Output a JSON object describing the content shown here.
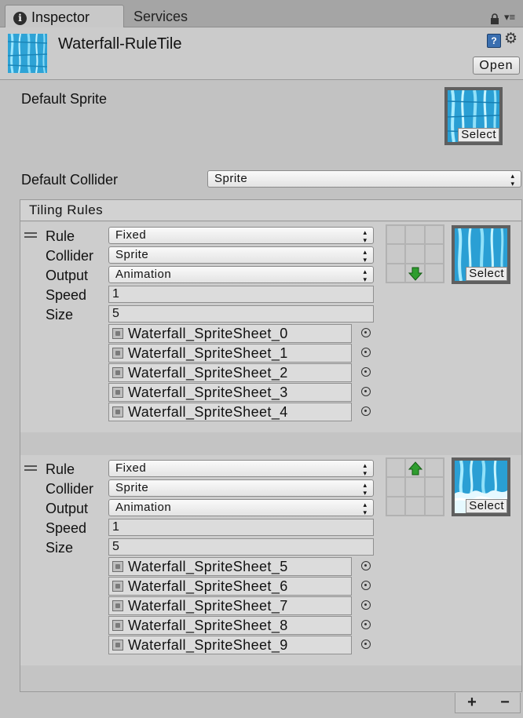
{
  "tabs": {
    "inspector": "Inspector",
    "services": "Services"
  },
  "asset": {
    "title": "Waterfall-RuleTile",
    "open_label": "Open"
  },
  "default_sprite": {
    "label": "Default Sprite",
    "select_label": "Select"
  },
  "default_collider": {
    "label": "Default Collider",
    "value": "Sprite"
  },
  "tiling_rules": {
    "title": "Tiling Rules",
    "field_labels": {
      "rule": "Rule",
      "collider": "Collider",
      "output": "Output",
      "speed": "Speed",
      "size": "Size"
    },
    "rules": [
      {
        "rule": "Fixed",
        "collider": "Sprite",
        "output": "Animation",
        "speed": "1",
        "size": "5",
        "sprites": [
          "Waterfall_SpriteSheet_0",
          "Waterfall_SpriteSheet_1",
          "Waterfall_SpriteSheet_2",
          "Waterfall_SpriteSheet_3",
          "Waterfall_SpriteSheet_4"
        ],
        "neighbor_arrow": "down",
        "select_label": "Select"
      },
      {
        "rule": "Fixed",
        "collider": "Sprite",
        "output": "Animation",
        "speed": "1",
        "size": "5",
        "sprites": [
          "Waterfall_SpriteSheet_5",
          "Waterfall_SpriteSheet_6",
          "Waterfall_SpriteSheet_7",
          "Waterfall_SpriteSheet_8",
          "Waterfall_SpriteSheet_9"
        ],
        "neighbor_arrow": "up",
        "select_label": "Select"
      }
    ]
  },
  "footer": {
    "add": "+",
    "remove": "−"
  },
  "colors": {
    "water_light": "#7fd8f5",
    "water_dark": "#1f8fc2",
    "arrow_green": "#2e9d2e"
  }
}
